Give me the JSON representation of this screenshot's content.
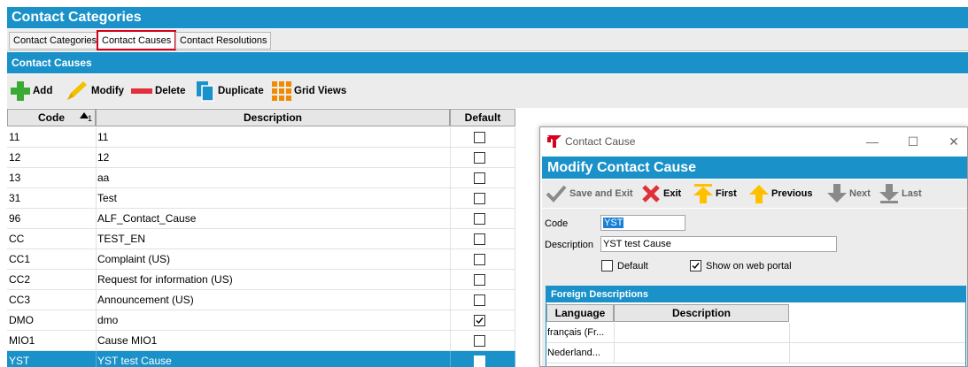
{
  "app": {
    "title": "Contact Categories"
  },
  "tabs": [
    {
      "label": "Contact Categories",
      "active": false
    },
    {
      "label": "Contact Causes",
      "active": true
    },
    {
      "label": "Contact Resolutions",
      "active": false
    }
  ],
  "section": {
    "title": "Contact Causes"
  },
  "toolbar": {
    "add": "Add",
    "modify": "Modify",
    "delete": "Delete",
    "duplicate": "Duplicate",
    "grid_views": "Grid Views"
  },
  "table": {
    "columns": {
      "code": "Code",
      "description": "Description",
      "default": "Default"
    },
    "sort_indicator": "1",
    "rows": [
      {
        "code": "11",
        "description": "11",
        "default": false,
        "selected": false
      },
      {
        "code": "12",
        "description": "12",
        "default": false,
        "selected": false
      },
      {
        "code": "13",
        "description": "aa",
        "default": false,
        "selected": false
      },
      {
        "code": "31",
        "description": "Test",
        "default": false,
        "selected": false
      },
      {
        "code": "96",
        "description": "ALF_Contact_Cause",
        "default": false,
        "selected": false
      },
      {
        "code": "CC",
        "description": "TEST_EN",
        "default": false,
        "selected": false
      },
      {
        "code": "CC1",
        "description": "Complaint (US)",
        "default": false,
        "selected": false
      },
      {
        "code": "CC2",
        "description": "Request for information (US)",
        "default": false,
        "selected": false
      },
      {
        "code": "CC3",
        "description": "Announcement (US)",
        "default": false,
        "selected": false
      },
      {
        "code": "DMO",
        "description": "dmo",
        "default": true,
        "selected": false
      },
      {
        "code": "MIO1",
        "description": "Cause MIO1",
        "default": false,
        "selected": false
      },
      {
        "code": "YST",
        "description": "YST test Cause",
        "default": false,
        "selected": true
      }
    ]
  },
  "dialog": {
    "window_title": "Contact Cause",
    "header": "Modify Contact Cause",
    "toolbar": {
      "save_exit": "Save and Exit",
      "exit": "Exit",
      "first": "First",
      "previous": "Previous",
      "next": "Next",
      "last": "Last"
    },
    "code_label": "Code",
    "code_value": "YST",
    "description_label": "Description",
    "description_value": "YST test Cause",
    "default_label": "Default",
    "default_checked": false,
    "web_portal_label": "Show on web portal",
    "web_portal_checked": true,
    "foreign": {
      "title": "Foreign Descriptions",
      "columns": {
        "language": "Language",
        "description": "Description"
      },
      "rows": [
        {
          "language": "français (Fr...",
          "description": ""
        },
        {
          "language": "Nederland...",
          "description": ""
        }
      ]
    }
  },
  "colors": {
    "accent": "#1a91c9",
    "active_tab_border": "#d6001c",
    "add_icon": "#3aaa35",
    "delete_icon": "#e0303a",
    "exit_icon": "#e0303a",
    "arrow_icon": "#ffc000",
    "pencil_icon": "#f2c200"
  },
  "icons": {
    "add": "plus-icon",
    "modify": "pencil-icon",
    "delete": "minus-icon",
    "duplicate": "duplicate-icon",
    "grid_views": "grid-icon",
    "save_exit": "checkmark-icon",
    "exit": "x-icon",
    "first": "arrow-up-first-icon",
    "previous": "arrow-up-icon",
    "next": "arrow-down-icon",
    "last": "arrow-down-last-icon"
  }
}
